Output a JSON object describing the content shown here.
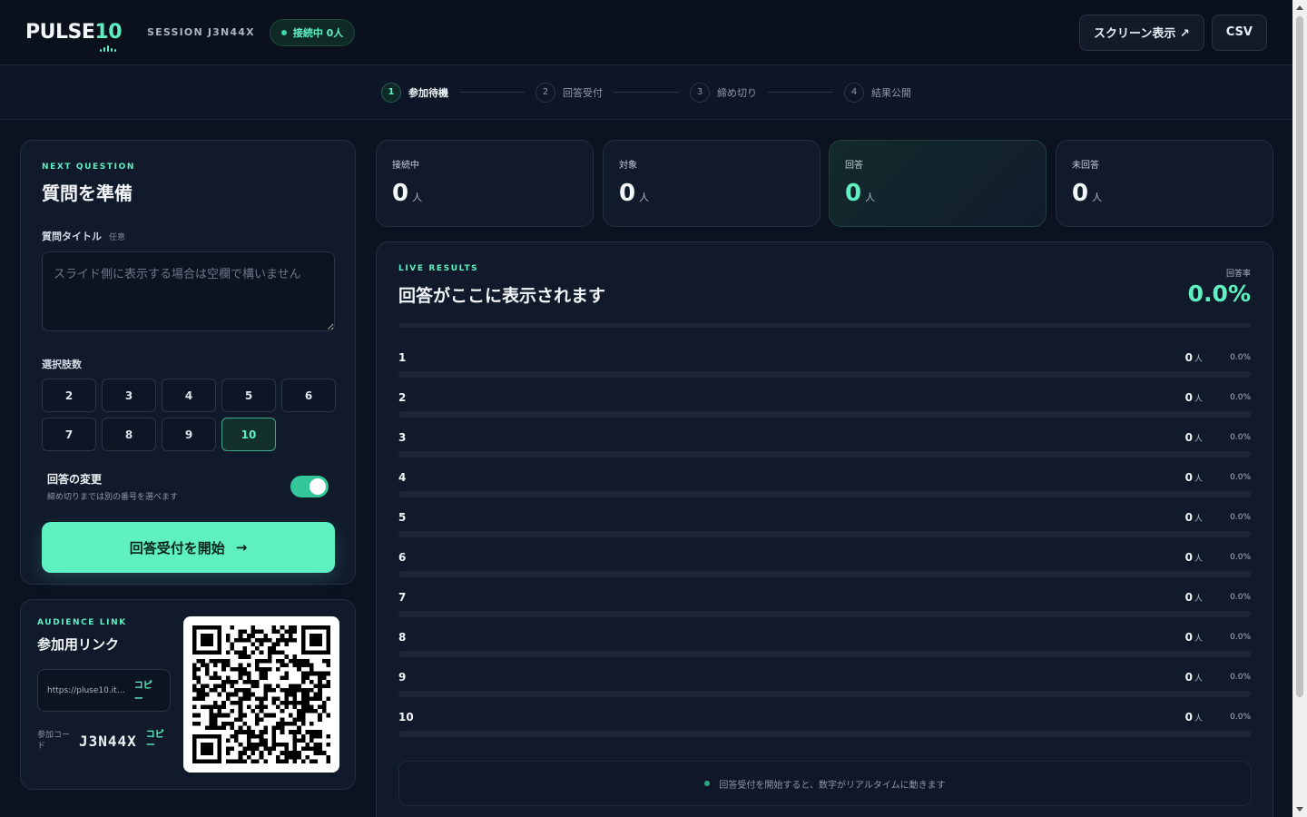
{
  "header": {
    "logo_text": "PULSE",
    "logo_num": "10",
    "session": "SESSION J3N44X",
    "connected_badge": "接続中 0人",
    "screen_button": "スクリーン表示 ↗",
    "csv_button": "CSV"
  },
  "steps": [
    {
      "num": "1",
      "label": "参加待機",
      "active": true
    },
    {
      "num": "2",
      "label": "回答受付",
      "active": false
    },
    {
      "num": "3",
      "label": "締め切り",
      "active": false
    },
    {
      "num": "4",
      "label": "結果公開",
      "active": false
    }
  ],
  "question": {
    "eyebrow": "NEXT QUESTION",
    "title": "質問を準備",
    "title_field_label": "質問タイトル",
    "title_field_optional": "任意",
    "title_field_value": "",
    "title_field_placeholder": "スライド側に表示する場合は空欄で構いません",
    "choices_label": "選択肢数",
    "choices": [
      "2",
      "3",
      "4",
      "5",
      "6",
      "7",
      "8",
      "9",
      "10"
    ],
    "selected_choice": "10",
    "toggle_title": "回答の変更",
    "toggle_sub": "締め切りまでは別の番号を選べます",
    "toggle_on": true,
    "start_button": "回答受付を開始",
    "start_arrow": "→"
  },
  "audience": {
    "eyebrow": "AUDIENCE LINK",
    "title": "参加用リンク",
    "link": "https://pluse10.ittr…",
    "copy_label": "コピー",
    "code_label": "参加コード",
    "code": "J3N44X",
    "code_copy_label": "コピー"
  },
  "stats": [
    {
      "label": "接続中",
      "value": "0",
      "unit": "人"
    },
    {
      "label": "対象",
      "value": "0",
      "unit": "人"
    },
    {
      "label": "回答",
      "value": "0",
      "unit": "人"
    },
    {
      "label": "未回答",
      "value": "0",
      "unit": "人"
    }
  ],
  "results": {
    "eyebrow": "LIVE RESULTS",
    "title": "回答がここに表示されます",
    "rate_label": "回答率",
    "rate_value": "0.0%",
    "rate_fraction": 0,
    "rows": [
      {
        "label": "1",
        "count": "0",
        "unit": "人",
        "pct": "0.0%",
        "fraction": 0
      },
      {
        "label": "2",
        "count": "0",
        "unit": "人",
        "pct": "0.0%",
        "fraction": 0
      },
      {
        "label": "3",
        "count": "0",
        "unit": "人",
        "pct": "0.0%",
        "fraction": 0
      },
      {
        "label": "4",
        "count": "0",
        "unit": "人",
        "pct": "0.0%",
        "fraction": 0
      },
      {
        "label": "5",
        "count": "0",
        "unit": "人",
        "pct": "0.0%",
        "fraction": 0
      },
      {
        "label": "6",
        "count": "0",
        "unit": "人",
        "pct": "0.0%",
        "fraction": 0
      },
      {
        "label": "7",
        "count": "0",
        "unit": "人",
        "pct": "0.0%",
        "fraction": 0
      },
      {
        "label": "8",
        "count": "0",
        "unit": "人",
        "pct": "0.0%",
        "fraction": 0
      },
      {
        "label": "9",
        "count": "0",
        "unit": "人",
        "pct": "0.0%",
        "fraction": 0
      },
      {
        "label": "10",
        "count": "0",
        "unit": "人",
        "pct": "0.0%",
        "fraction": 0
      }
    ],
    "footnote": "回答受付を開始すると、数字がリアルタイムに動きます"
  },
  "colors": {
    "accent": "#5ef0c1",
    "background": "#0b1220",
    "card": "#111a2b"
  },
  "icons": {
    "qr": "qr-code-icon",
    "status": "status-dot-icon",
    "external": "external-link-icon",
    "arrow": "arrow-right-icon"
  }
}
